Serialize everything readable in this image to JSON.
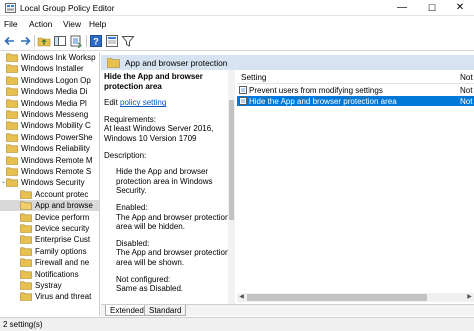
{
  "window": {
    "title": "Local Group Policy Editor"
  },
  "menu": [
    "File",
    "Action",
    "View",
    "Help"
  ],
  "toolbar": {
    "icons": [
      "back-icon",
      "forward-icon",
      "up-folder-icon",
      "show-hide-tree-icon",
      "export-list-icon",
      "help-icon",
      "properties-icon",
      "filter-icon"
    ]
  },
  "tree": {
    "items": [
      {
        "label": "Windows Ink Workspace",
        "display": "Windows Ink Worksp"
      },
      {
        "label": "Windows Installer",
        "display": "Windows Installer"
      },
      {
        "label": "Windows Logon Options",
        "display": "Windows Logon Op"
      },
      {
        "label": "Windows Media Digital Rights Management",
        "display": "Windows Media Di"
      },
      {
        "label": "Windows Media Player",
        "display": "Windows Media Pl"
      },
      {
        "label": "Windows Messenger",
        "display": "Windows Messeng"
      },
      {
        "label": "Windows Mobility Center",
        "display": "Windows Mobility C"
      },
      {
        "label": "Windows PowerShell",
        "display": "Windows PowerShe"
      },
      {
        "label": "Windows Reliability Analysis",
        "display": "Windows Reliability"
      },
      {
        "label": "Windows Remote Management",
        "display": "Windows Remote M"
      },
      {
        "label": "Windows Remote Shell",
        "display": "Windows Remote S"
      },
      {
        "label": "Windows Security",
        "display": "Windows Security"
      },
      {
        "label": "Account protection",
        "display": "Account protec"
      },
      {
        "label": "App and browser protection",
        "display": "App and browse"
      },
      {
        "label": "Device performance and health",
        "display": "Device perform"
      },
      {
        "label": "Device security",
        "display": "Device security"
      },
      {
        "label": "Enterprise Customization",
        "display": "Enterprise Cust"
      },
      {
        "label": "Family options",
        "display": "Family options"
      },
      {
        "label": "Firewall and network protection",
        "display": "Firewall and ne"
      },
      {
        "label": "Notifications",
        "display": "Notifications"
      },
      {
        "label": "Systray",
        "display": "Systray"
      },
      {
        "label": "Virus and threat protection",
        "display": "Virus and threat"
      }
    ]
  },
  "header": {
    "title": "App and browser protection"
  },
  "description": {
    "heading": "Hide the App and browser protection area",
    "edit_prefix": "Edit",
    "edit_link": "policy setting",
    "requirements_label": "Requirements:",
    "requirements": "At least Windows Server 2016, Windows 10 Version 1709",
    "description_label": "Description:",
    "description_text": "Hide the App and browser protection area in Windows Security.",
    "enabled_label": "Enabled:",
    "enabled_text": "The App and browser protection area will be hidden.",
    "disabled_label": "Disabled:",
    "disabled_text": "The App and browser protection area will be shown.",
    "notconfigured_label": "Not configured:",
    "notconfigured_text": "Same as Disabled."
  },
  "list": {
    "column_setting": "Setting",
    "column_state": "Not",
    "rows": [
      {
        "setting": "Prevent users from modifying settings",
        "state": "Not"
      },
      {
        "setting": "Hide the App and browser protection area",
        "state": "Not"
      }
    ]
  },
  "tabs": [
    "Extended",
    "Standard"
  ],
  "status": {
    "text": "2 setting(s)"
  },
  "colors": {
    "header_band": "#d7e3f1",
    "selection": "#0078d7",
    "link": "#0b55c4"
  }
}
